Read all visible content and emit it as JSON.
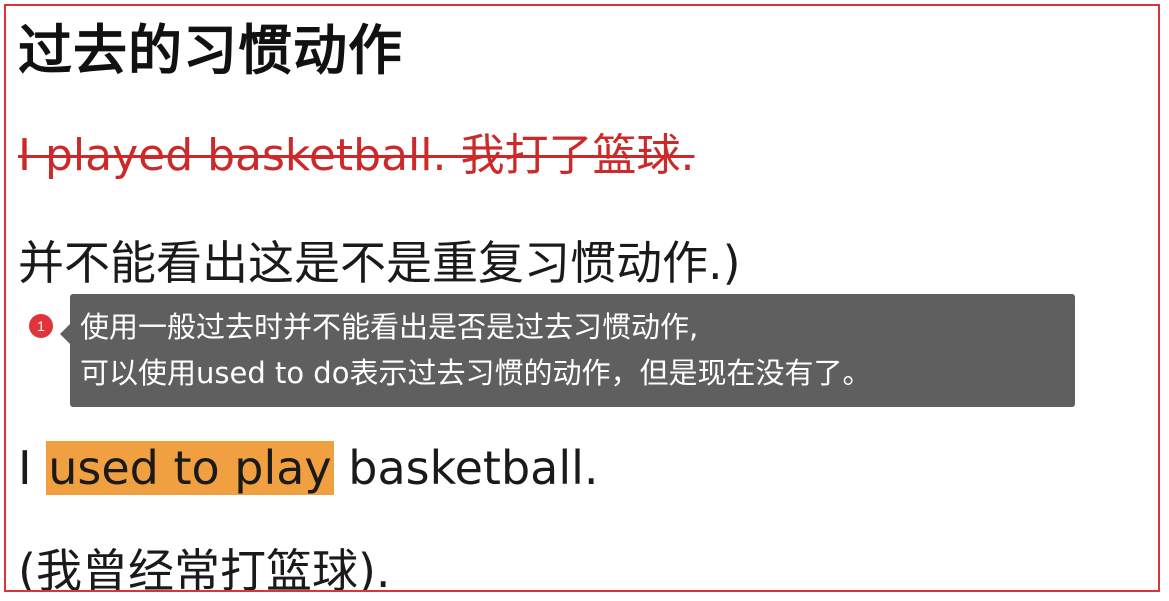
{
  "title": "过去的习惯动作",
  "struck_example": "I played basketball. 我打了篮球.",
  "note_line": "并不能看出这是不是重复习惯动作.)",
  "example": {
    "prefix": "I ",
    "highlight": "used to play",
    "suffix": " basketball."
  },
  "translation": "(我曾经常打篮球).",
  "annotation": {
    "number": "1",
    "lines": [
      "使用一般过去时并不能看出是否是过去习惯动作,",
      "可以使用used to do表示过去习惯的动作，但是现在没有了。"
    ]
  },
  "colors": {
    "frame_border": "#d9343a",
    "strikethrough": "#cc2a2a",
    "highlight": "#f0a040",
    "tooltip_bg": "#5f5f5f",
    "marker": "#e0343a"
  }
}
